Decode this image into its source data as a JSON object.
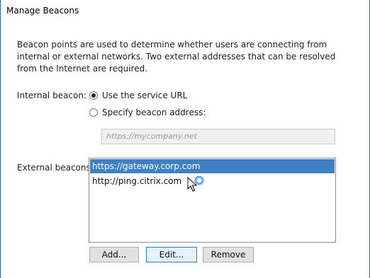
{
  "window": {
    "title": "Manage Beacons"
  },
  "description": "Beacon points are used to determine whether users are connecting from internal or external networks. Two external addresses that can be resolved from the Internet are required.",
  "internal": {
    "label": "Internal beacon:",
    "option_service_url": "Use the service URL",
    "option_specify": "Specify beacon address:",
    "selected": "service_url",
    "address_placeholder": "https://mycompany.net"
  },
  "external": {
    "label": "External beacons:",
    "items": [
      "https://gateway.corp.com",
      "http://ping.citrix.com"
    ],
    "selected_index": 0
  },
  "buttons": {
    "add": "Add...",
    "edit": "Edit...",
    "remove": "Remove"
  },
  "colors": {
    "selection": "#3e80c8",
    "window_border": "#1c6fb8"
  },
  "cursor_icon": "arrow-busy-cursor-icon"
}
